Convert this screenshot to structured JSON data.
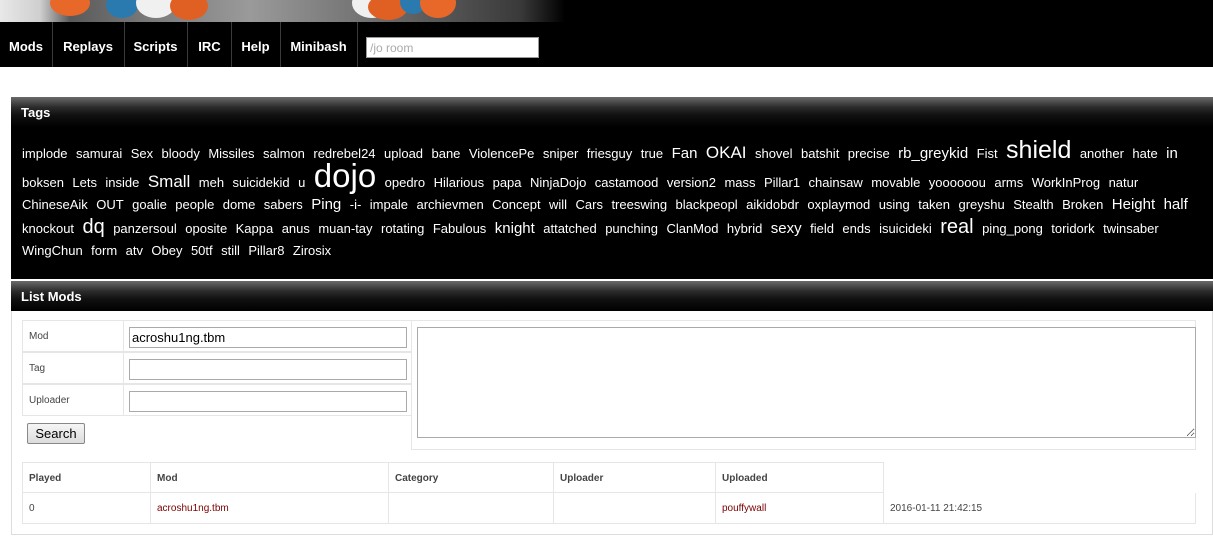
{
  "nav": {
    "items": [
      "Mods",
      "Replays",
      "Scripts",
      "IRC",
      "Help",
      "Minibash"
    ],
    "room_placeholder": "/jo room"
  },
  "tags_panel": {
    "title": "Tags",
    "tags": [
      {
        "t": "implode",
        "s": 1
      },
      {
        "t": "samurai",
        "s": 1
      },
      {
        "t": "Sex",
        "s": 1
      },
      {
        "t": "bloody",
        "s": 1
      },
      {
        "t": "Missiles",
        "s": 1
      },
      {
        "t": "salmon",
        "s": 1
      },
      {
        "t": "redrebel24",
        "s": 1
      },
      {
        "t": "upload",
        "s": 1
      },
      {
        "t": "bane",
        "s": 1
      },
      {
        "t": "ViolencePe",
        "s": 1
      },
      {
        "t": "sniper",
        "s": 1
      },
      {
        "t": "friesguy",
        "s": 1
      },
      {
        "t": "true",
        "s": 1
      },
      {
        "t": "Fan",
        "s": 2
      },
      {
        "t": "OKAI",
        "s": 3
      },
      {
        "t": "shovel",
        "s": 1
      },
      {
        "t": "batshit",
        "s": 1
      },
      {
        "t": "precise",
        "s": 1
      },
      {
        "t": "rb_greykid",
        "s": 2
      },
      {
        "t": "Fist",
        "s": 1
      },
      {
        "t": "shield",
        "s": 5
      },
      {
        "t": "another",
        "s": 1
      },
      {
        "t": "hate",
        "s": 1
      },
      {
        "t": "in",
        "s": 2
      },
      {
        "t": "boksen",
        "s": 1
      },
      {
        "t": "Lets",
        "s": 1
      },
      {
        "t": "inside",
        "s": 1
      },
      {
        "t": "Small",
        "s": 3
      },
      {
        "t": "meh",
        "s": 1
      },
      {
        "t": "suicidekid",
        "s": 1
      },
      {
        "t": "u",
        "s": 1
      },
      {
        "t": "dojo",
        "s": 6
      },
      {
        "t": "opedro",
        "s": 1
      },
      {
        "t": "Hilarious",
        "s": 1
      },
      {
        "t": "papa",
        "s": 1
      },
      {
        "t": "NinjaDojo",
        "s": 1
      },
      {
        "t": "castamood",
        "s": 1
      },
      {
        "t": "version2",
        "s": 1
      },
      {
        "t": "mass",
        "s": 1
      },
      {
        "t": "Pillar1",
        "s": 1
      },
      {
        "t": "chainsaw",
        "s": 1
      },
      {
        "t": "movable",
        "s": 1
      },
      {
        "t": "yoooooou",
        "s": 1
      },
      {
        "t": "arms",
        "s": 1
      },
      {
        "t": "WorkInProg",
        "s": 1
      },
      {
        "t": "natur",
        "s": 1
      },
      {
        "t": "ChineseAik",
        "s": 1
      },
      {
        "t": "OUT",
        "s": 1
      },
      {
        "t": "goalie",
        "s": 1
      },
      {
        "t": "people",
        "s": 1
      },
      {
        "t": "dome",
        "s": 1
      },
      {
        "t": "sabers",
        "s": 1
      },
      {
        "t": "Ping",
        "s": 2
      },
      {
        "t": "-i-",
        "s": 1
      },
      {
        "t": "impale",
        "s": 1
      },
      {
        "t": "archievmen",
        "s": 1
      },
      {
        "t": "Concept",
        "s": 1
      },
      {
        "t": "will",
        "s": 1
      },
      {
        "t": "Cars",
        "s": 1
      },
      {
        "t": "treeswing",
        "s": 1
      },
      {
        "t": "blackpeopl",
        "s": 1
      },
      {
        "t": "aikidobdr",
        "s": 1
      },
      {
        "t": "oxplaymod",
        "s": 1
      },
      {
        "t": "using",
        "s": 1
      },
      {
        "t": "taken",
        "s": 1
      },
      {
        "t": "greyshu",
        "s": 1
      },
      {
        "t": "Stealth",
        "s": 1
      },
      {
        "t": "Broken",
        "s": 1
      },
      {
        "t": "Height",
        "s": 2
      },
      {
        "t": "half",
        "s": 2
      },
      {
        "t": "knockout",
        "s": 1
      },
      {
        "t": "dq",
        "s": 4
      },
      {
        "t": "panzersoul",
        "s": 1
      },
      {
        "t": "oposite",
        "s": 1
      },
      {
        "t": "Kappa",
        "s": 1
      },
      {
        "t": "anus",
        "s": 1
      },
      {
        "t": "muan-tay",
        "s": 1
      },
      {
        "t": "rotating",
        "s": 1
      },
      {
        "t": "Fabulous",
        "s": 1
      },
      {
        "t": "knight",
        "s": 2
      },
      {
        "t": "attatched",
        "s": 1
      },
      {
        "t": "punching",
        "s": 1
      },
      {
        "t": "ClanMod",
        "s": 1
      },
      {
        "t": "hybrid",
        "s": 1
      },
      {
        "t": "sexy",
        "s": 2
      },
      {
        "t": "field",
        "s": 1
      },
      {
        "t": "ends",
        "s": 1
      },
      {
        "t": "isuicideki",
        "s": 1
      },
      {
        "t": "real",
        "s": 4
      },
      {
        "t": "ping_pong",
        "s": 1
      },
      {
        "t": "toridork",
        "s": 1
      },
      {
        "t": "twinsaber",
        "s": 1
      },
      {
        "t": "WingChun",
        "s": 1
      },
      {
        "t": "form",
        "s": 1
      },
      {
        "t": "atv",
        "s": 1
      },
      {
        "t": "Obey",
        "s": 1
      },
      {
        "t": "50tf",
        "s": 1
      },
      {
        "t": "still",
        "s": 1
      },
      {
        "t": "Pillar8",
        "s": 1
      },
      {
        "t": "Zirosix",
        "s": 1
      }
    ]
  },
  "list_panel": {
    "title": "List Mods",
    "form": {
      "mod_label": "Mod",
      "mod_value": "acroshu1ng.tbm",
      "tag_label": "Tag",
      "tag_value": "",
      "uploader_label": "Uploader",
      "uploader_value": "",
      "search_label": "Search"
    },
    "table": {
      "headers": [
        "Played",
        "Mod",
        "Category",
        "Uploader",
        "Uploaded"
      ],
      "rows": [
        {
          "played": "0",
          "mod": "acroshu1ng.tbm",
          "category": "",
          "uploader": "",
          "uploaded": "pouffywall",
          "date": "2016-01-11 21:42:15"
        }
      ]
    }
  },
  "colors": {
    "nav_bg": "#000000",
    "link": "#7a0000",
    "tag_text": "#ffffff"
  }
}
